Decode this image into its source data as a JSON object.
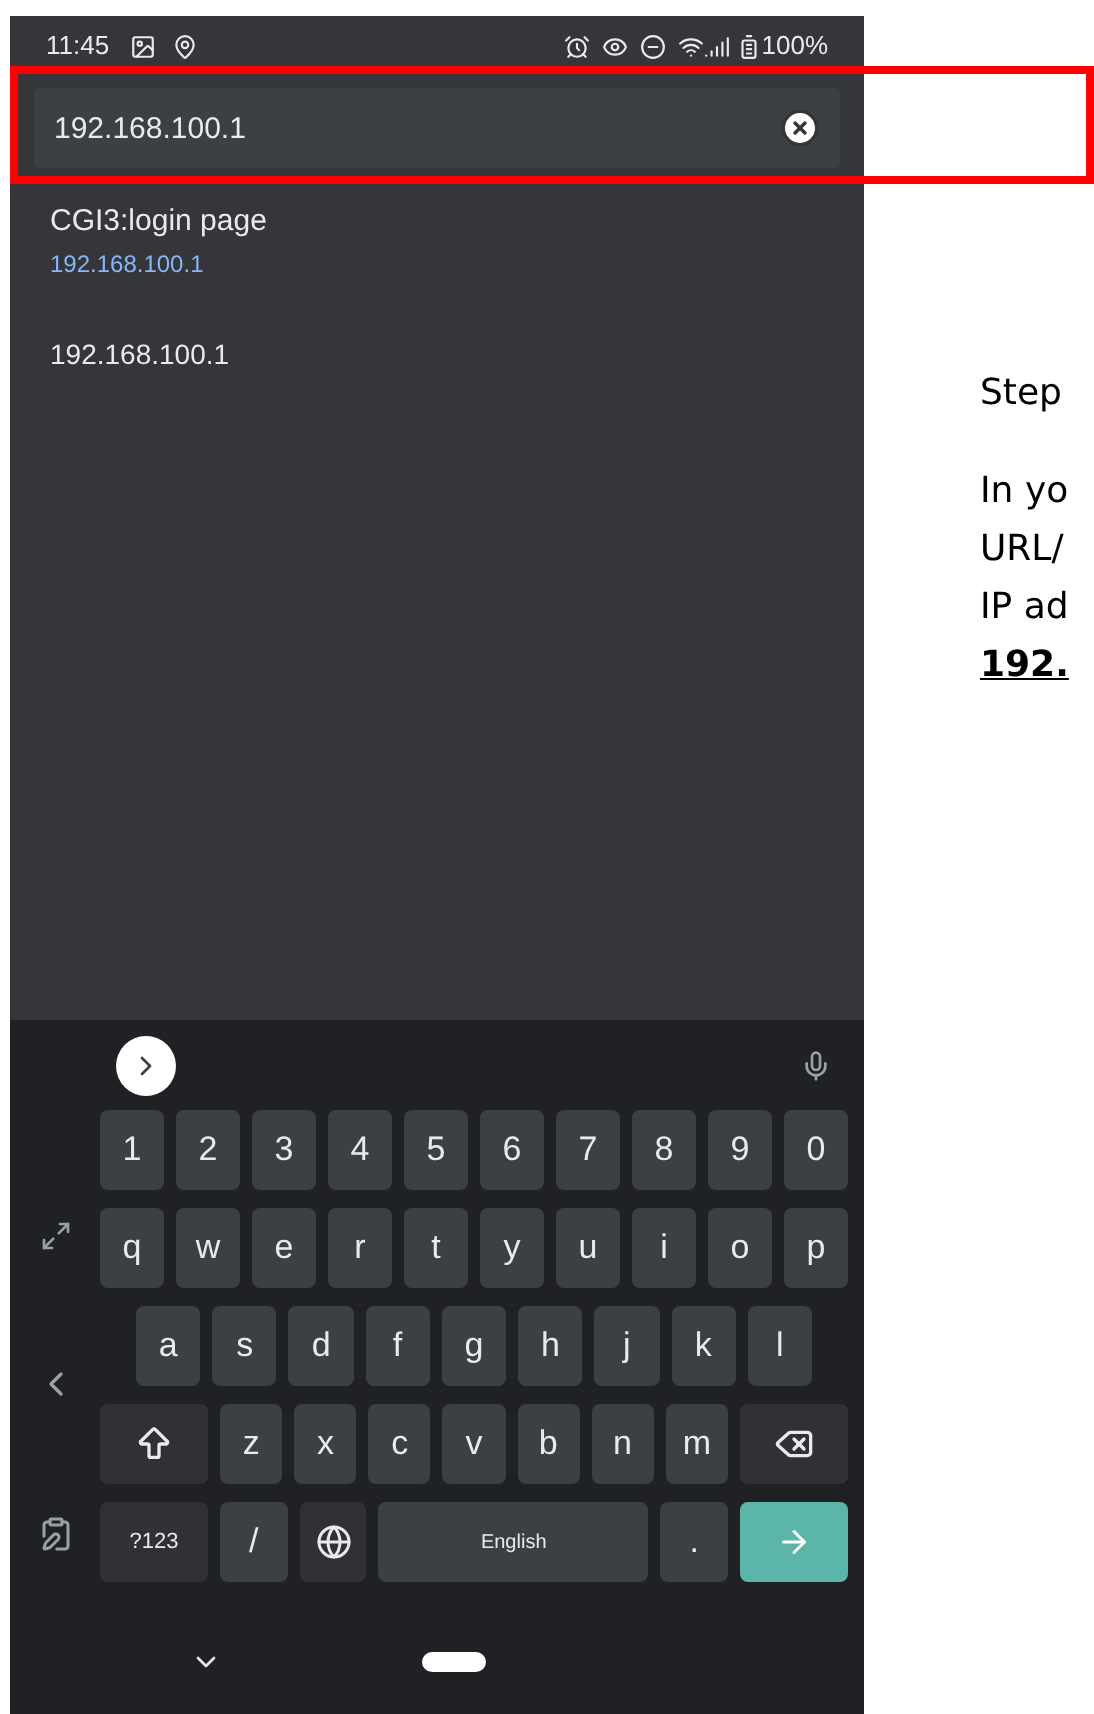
{
  "status_bar": {
    "time": "11:45",
    "battery": "100%"
  },
  "address_bar": {
    "value": "192.168.100.1"
  },
  "suggestions": [
    {
      "title": "CGI3:login page",
      "url": "192.168.100.1"
    },
    {
      "url": "192.168.100.1"
    }
  ],
  "keyboard": {
    "rows": [
      [
        {
          "kind": "char",
          "label": "1"
        },
        {
          "kind": "char",
          "label": "2"
        },
        {
          "kind": "char",
          "label": "3"
        },
        {
          "kind": "char",
          "label": "4"
        },
        {
          "kind": "char",
          "label": "5"
        },
        {
          "kind": "char",
          "label": "6"
        },
        {
          "kind": "char",
          "label": "7"
        },
        {
          "kind": "char",
          "label": "8"
        },
        {
          "kind": "char",
          "label": "9"
        },
        {
          "kind": "char",
          "label": "0"
        }
      ],
      [
        {
          "kind": "char",
          "label": "q"
        },
        {
          "kind": "char",
          "label": "w"
        },
        {
          "kind": "char",
          "label": "e"
        },
        {
          "kind": "char",
          "label": "r"
        },
        {
          "kind": "char",
          "label": "t"
        },
        {
          "kind": "char",
          "label": "y"
        },
        {
          "kind": "char",
          "label": "u"
        },
        {
          "kind": "char",
          "label": "i"
        },
        {
          "kind": "char",
          "label": "o"
        },
        {
          "kind": "char",
          "label": "p"
        }
      ],
      [
        {
          "kind": "char",
          "label": "a"
        },
        {
          "kind": "char",
          "label": "s"
        },
        {
          "kind": "char",
          "label": "d"
        },
        {
          "kind": "char",
          "label": "f"
        },
        {
          "kind": "char",
          "label": "g"
        },
        {
          "kind": "char",
          "label": "h"
        },
        {
          "kind": "char",
          "label": "j"
        },
        {
          "kind": "char",
          "label": "k"
        },
        {
          "kind": "char",
          "label": "l"
        }
      ],
      [
        {
          "kind": "shift"
        },
        {
          "kind": "char",
          "label": "z"
        },
        {
          "kind": "char",
          "label": "x"
        },
        {
          "kind": "char",
          "label": "c"
        },
        {
          "kind": "char",
          "label": "v"
        },
        {
          "kind": "char",
          "label": "b"
        },
        {
          "kind": "char",
          "label": "n"
        },
        {
          "kind": "char",
          "label": "m"
        },
        {
          "kind": "backspace"
        }
      ],
      [
        {
          "kind": "symbols",
          "label": "?123"
        },
        {
          "kind": "char",
          "label": "/"
        },
        {
          "kind": "globe"
        },
        {
          "kind": "space",
          "label": "English"
        },
        {
          "kind": "char",
          "label": "."
        },
        {
          "kind": "enter"
        }
      ]
    ]
  },
  "document": {
    "lines": [
      {
        "text": "Step",
        "bold": false
      },
      {
        "text": "In yo",
        "bold": false
      },
      {
        "text": "URL/",
        "bold": false
      },
      {
        "text": "IP ad",
        "bold": false
      },
      {
        "text": "192.",
        "bold": true
      }
    ]
  }
}
